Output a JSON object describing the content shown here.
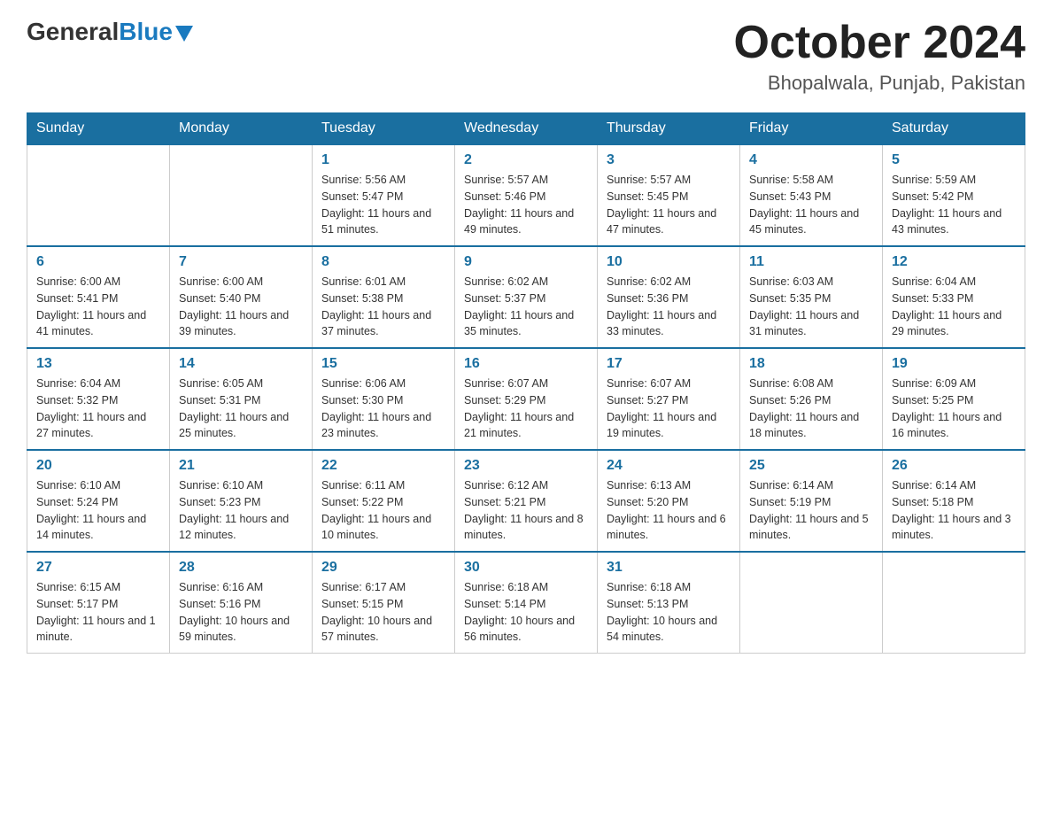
{
  "header": {
    "logo": {
      "general": "General",
      "blue": "Blue"
    },
    "month_year": "October 2024",
    "location": "Bhopalwala, Punjab, Pakistan"
  },
  "days_of_week": [
    "Sunday",
    "Monday",
    "Tuesday",
    "Wednesday",
    "Thursday",
    "Friday",
    "Saturday"
  ],
  "weeks": [
    [
      {
        "day": "",
        "info": ""
      },
      {
        "day": "",
        "info": ""
      },
      {
        "day": "1",
        "info": "Sunrise: 5:56 AM\nSunset: 5:47 PM\nDaylight: 11 hours\nand 51 minutes."
      },
      {
        "day": "2",
        "info": "Sunrise: 5:57 AM\nSunset: 5:46 PM\nDaylight: 11 hours\nand 49 minutes."
      },
      {
        "day": "3",
        "info": "Sunrise: 5:57 AM\nSunset: 5:45 PM\nDaylight: 11 hours\nand 47 minutes."
      },
      {
        "day": "4",
        "info": "Sunrise: 5:58 AM\nSunset: 5:43 PM\nDaylight: 11 hours\nand 45 minutes."
      },
      {
        "day": "5",
        "info": "Sunrise: 5:59 AM\nSunset: 5:42 PM\nDaylight: 11 hours\nand 43 minutes."
      }
    ],
    [
      {
        "day": "6",
        "info": "Sunrise: 6:00 AM\nSunset: 5:41 PM\nDaylight: 11 hours\nand 41 minutes."
      },
      {
        "day": "7",
        "info": "Sunrise: 6:00 AM\nSunset: 5:40 PM\nDaylight: 11 hours\nand 39 minutes."
      },
      {
        "day": "8",
        "info": "Sunrise: 6:01 AM\nSunset: 5:38 PM\nDaylight: 11 hours\nand 37 minutes."
      },
      {
        "day": "9",
        "info": "Sunrise: 6:02 AM\nSunset: 5:37 PM\nDaylight: 11 hours\nand 35 minutes."
      },
      {
        "day": "10",
        "info": "Sunrise: 6:02 AM\nSunset: 5:36 PM\nDaylight: 11 hours\nand 33 minutes."
      },
      {
        "day": "11",
        "info": "Sunrise: 6:03 AM\nSunset: 5:35 PM\nDaylight: 11 hours\nand 31 minutes."
      },
      {
        "day": "12",
        "info": "Sunrise: 6:04 AM\nSunset: 5:33 PM\nDaylight: 11 hours\nand 29 minutes."
      }
    ],
    [
      {
        "day": "13",
        "info": "Sunrise: 6:04 AM\nSunset: 5:32 PM\nDaylight: 11 hours\nand 27 minutes."
      },
      {
        "day": "14",
        "info": "Sunrise: 6:05 AM\nSunset: 5:31 PM\nDaylight: 11 hours\nand 25 minutes."
      },
      {
        "day": "15",
        "info": "Sunrise: 6:06 AM\nSunset: 5:30 PM\nDaylight: 11 hours\nand 23 minutes."
      },
      {
        "day": "16",
        "info": "Sunrise: 6:07 AM\nSunset: 5:29 PM\nDaylight: 11 hours\nand 21 minutes."
      },
      {
        "day": "17",
        "info": "Sunrise: 6:07 AM\nSunset: 5:27 PM\nDaylight: 11 hours\nand 19 minutes."
      },
      {
        "day": "18",
        "info": "Sunrise: 6:08 AM\nSunset: 5:26 PM\nDaylight: 11 hours\nand 18 minutes."
      },
      {
        "day": "19",
        "info": "Sunrise: 6:09 AM\nSunset: 5:25 PM\nDaylight: 11 hours\nand 16 minutes."
      }
    ],
    [
      {
        "day": "20",
        "info": "Sunrise: 6:10 AM\nSunset: 5:24 PM\nDaylight: 11 hours\nand 14 minutes."
      },
      {
        "day": "21",
        "info": "Sunrise: 6:10 AM\nSunset: 5:23 PM\nDaylight: 11 hours\nand 12 minutes."
      },
      {
        "day": "22",
        "info": "Sunrise: 6:11 AM\nSunset: 5:22 PM\nDaylight: 11 hours\nand 10 minutes."
      },
      {
        "day": "23",
        "info": "Sunrise: 6:12 AM\nSunset: 5:21 PM\nDaylight: 11 hours\nand 8 minutes."
      },
      {
        "day": "24",
        "info": "Sunrise: 6:13 AM\nSunset: 5:20 PM\nDaylight: 11 hours\nand 6 minutes."
      },
      {
        "day": "25",
        "info": "Sunrise: 6:14 AM\nSunset: 5:19 PM\nDaylight: 11 hours\nand 5 minutes."
      },
      {
        "day": "26",
        "info": "Sunrise: 6:14 AM\nSunset: 5:18 PM\nDaylight: 11 hours\nand 3 minutes."
      }
    ],
    [
      {
        "day": "27",
        "info": "Sunrise: 6:15 AM\nSunset: 5:17 PM\nDaylight: 11 hours\nand 1 minute."
      },
      {
        "day": "28",
        "info": "Sunrise: 6:16 AM\nSunset: 5:16 PM\nDaylight: 10 hours\nand 59 minutes."
      },
      {
        "day": "29",
        "info": "Sunrise: 6:17 AM\nSunset: 5:15 PM\nDaylight: 10 hours\nand 57 minutes."
      },
      {
        "day": "30",
        "info": "Sunrise: 6:18 AM\nSunset: 5:14 PM\nDaylight: 10 hours\nand 56 minutes."
      },
      {
        "day": "31",
        "info": "Sunrise: 6:18 AM\nSunset: 5:13 PM\nDaylight: 10 hours\nand 54 minutes."
      },
      {
        "day": "",
        "info": ""
      },
      {
        "day": "",
        "info": ""
      }
    ]
  ]
}
